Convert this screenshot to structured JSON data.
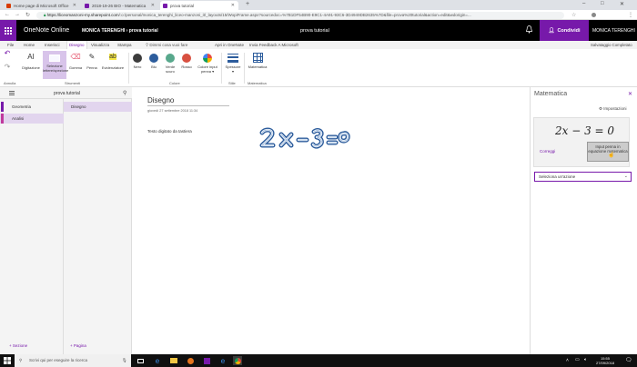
{
  "browser": {
    "tabs": [
      {
        "label": "Home page di Microsoft Office",
        "favicon_color": "#d83b01"
      },
      {
        "label": "2018-19-26 BIO - Matematica",
        "favicon_color": "#7719aa"
      },
      {
        "label": "prova tutorial",
        "favicon_color": "#7719aa"
      }
    ],
    "new_tab": "+",
    "url_host": "https://liceomanzoni-my.sharepoint.com",
    "url_path": "/:o:/personal/monica_terenghi_liceo-manzoni_it/_layouts/15/WopiFrame.aspx?sourcedoc=%7B1DF54B90-E9C1-4A91-93C6-3D4949DB2635%7D&file=prova%20tutorial&action=edit&wdorigin=...",
    "window_controls": [
      "–",
      "□",
      "✕"
    ]
  },
  "onenote": {
    "app_name": "OneNote Online",
    "breadcrumb": "MONICA TERENGHI › prova tutorial",
    "doc_title": "prova tutorial",
    "share_label": "Condividi",
    "user_name": "MONICA TERENGHI"
  },
  "ribbon_tabs": {
    "tabs": [
      "File",
      "Home",
      "Inserisci",
      "Disegno",
      "Visualizza",
      "Stampa"
    ],
    "selected": "Disegno",
    "tell_me": "Dimmi cosa vuoi fare",
    "links": [
      "Apri in OneNote",
      "Invia Feedback A Microsoft"
    ],
    "saved": "Salvataggio Completato"
  },
  "ribbon": {
    "buttons": {
      "typing": "Digitazione",
      "lasso": "Selezione lettere/spezione",
      "eraser": "Gomma",
      "pen": "Penna",
      "highlighter": "Evidenziatore",
      "black": "Nero",
      "blue": "Blu",
      "green": "Verde scuro",
      "red": "Rosso",
      "ink_colors": "Colore input penna ▾",
      "thickness": "Spessore ▾",
      "math": "Matematica"
    },
    "groups": [
      "Annulla",
      "Strumenti",
      "Colore",
      "Stile",
      "Matematica"
    ],
    "colors": {
      "black": "#3c3c3c",
      "blue": "#2c5c9c",
      "green": "#58a88c",
      "red": "#d85040"
    }
  },
  "nav": {
    "notebook_name": "prova tutorial",
    "sections": [
      {
        "label": "Geometria",
        "color": "#7719aa",
        "selected": false
      },
      {
        "label": "Analisi",
        "color": "#c0399c",
        "selected": true
      }
    ],
    "pages": [
      {
        "label": "Disegno",
        "selected": true
      }
    ],
    "add_section": "+ Sezione",
    "add_page": "+ Pagina"
  },
  "page": {
    "title": "Disegno",
    "date": "giovedì 27 settembre 2018    11:34",
    "typed_text": "Testo digitato da tastiera"
  },
  "math_pane": {
    "title": "Matematica",
    "settings": "Impostazioni",
    "equation": "2x − 3 = 0",
    "correct": "Correggi",
    "ink_button": "Input penna in equazione matematica",
    "select_action": "Seleziona un'azione"
  },
  "taskbar": {
    "search_placeholder": "Scrivi qui per eseguire la ricerca",
    "time": "15:55",
    "date": "27/09/2018"
  }
}
